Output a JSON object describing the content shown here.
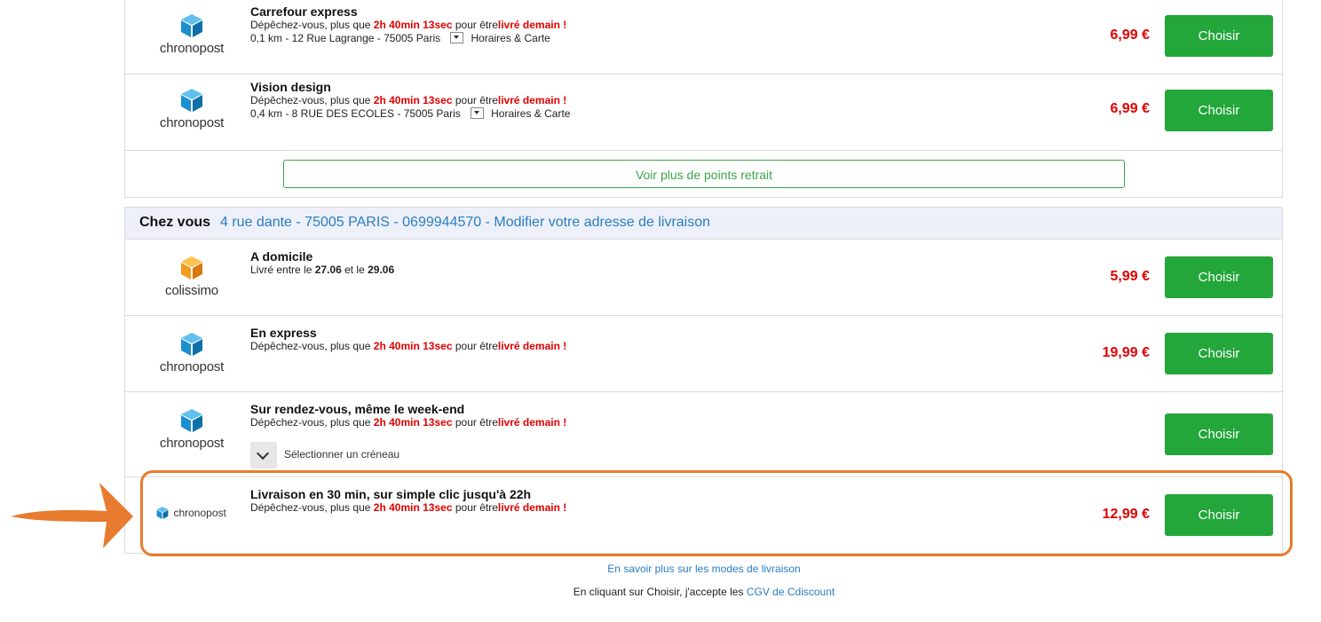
{
  "relay": {
    "items": [
      {
        "title": "Carrefour express",
        "hurry_prefix": "Dépêchez-vous, plus que",
        "countdown": "2h 40min 13sec",
        "hurry_mid": "pour être",
        "delivered": "livré demain !",
        "address": "0,1 km - 12 Rue Lagrange - 75005 Paris",
        "hours_label": "Horaires & Carte",
        "carrier": "chronopost",
        "price": "6,99 €",
        "button": "Choisir"
      },
      {
        "title": "Vision design",
        "hurry_prefix": "Dépêchez-vous, plus que",
        "countdown": "2h 40min 13sec",
        "hurry_mid": "pour être",
        "delivered": "livré demain !",
        "address": "0,4 km - 8 RUE DES ECOLES - 75005 Paris",
        "hours_label": "Horaires & Carte",
        "carrier": "chronopost",
        "price": "6,99 €",
        "button": "Choisir"
      }
    ],
    "more_button": "Voir plus de points retrait"
  },
  "home": {
    "label": "Chez vous",
    "address": "4 rue dante - 75005 PARIS - 0699944570 - Modifier votre adresse de livraison",
    "options": [
      {
        "title": "A domicile",
        "between_prefix": "Livré entre le",
        "date_from": "27.06",
        "between_mid": "et le",
        "date_to": "29.06",
        "carrier": "colissimo",
        "price": "5,99 €",
        "button": "Choisir"
      },
      {
        "title": "En express",
        "hurry_prefix": "Dépêchez-vous, plus que",
        "countdown": "2h 40min 13sec",
        "hurry_mid": "pour être",
        "delivered": "livré demain !",
        "carrier": "chronopost",
        "price": "19,99 €",
        "button": "Choisir"
      },
      {
        "title": "Sur rendez-vous, même le week-end",
        "hurry_prefix": "Dépêchez-vous, plus que",
        "countdown": "2h 40min 13sec",
        "hurry_mid": "pour être",
        "delivered": "livré demain !",
        "slot_label": "Sélectionner un créneau",
        "carrier": "chronopost",
        "button": "Choisir"
      },
      {
        "title": "Livraison en 30 min, sur simple clic jusqu'à 22h",
        "hurry_prefix": "Dépêchez-vous, plus que",
        "countdown": "2h 40min 13sec",
        "hurry_mid": "pour être",
        "delivered": "livré demain !",
        "carrier": "chronopost",
        "price": "12,99 €",
        "button": "Choisir"
      }
    ]
  },
  "footer": {
    "learn_more": "En savoir plus sur les modes de livraison",
    "cgv_prefix": "En cliquant sur Choisir, j'accepte les",
    "cgv_link": "CGV de Cdiscount"
  },
  "colors": {
    "accent_green": "#23a63a",
    "price_red": "#e10000",
    "link_blue": "#2a7ec2",
    "highlight_orange": "#e87b2e",
    "chronopost_blue": "#1b8fd0",
    "colissimo_orange": "#f39a1f"
  },
  "icons": {
    "chronopost": "chronopost-cube-icon",
    "colissimo": "colissimo-cube-icon",
    "dropdown": "dropdown-caret-icon",
    "chevron": "chevron-down-icon",
    "arrow": "pointer-arrow-icon"
  }
}
